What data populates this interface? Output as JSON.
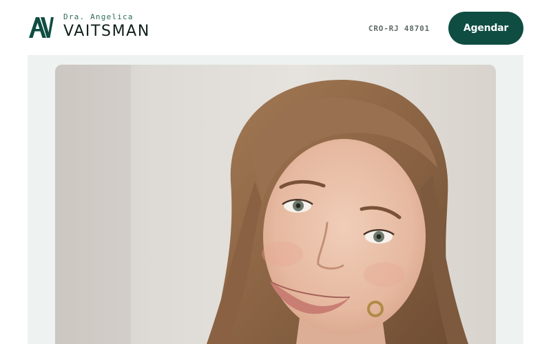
{
  "brand": {
    "monogram": "AV",
    "first_name": "Dra. Angelica",
    "last_name": "VAITSMAN"
  },
  "header": {
    "license": "CRO-RJ 48701",
    "cta_label": "Agendar"
  },
  "hero": {
    "image_alt": "Retrato da Dra. Angelica Vaitsman"
  },
  "colors": {
    "brand_green": "#0f4d42",
    "accent_green": "#2e6b57",
    "hero_background": "#eef3f1"
  }
}
